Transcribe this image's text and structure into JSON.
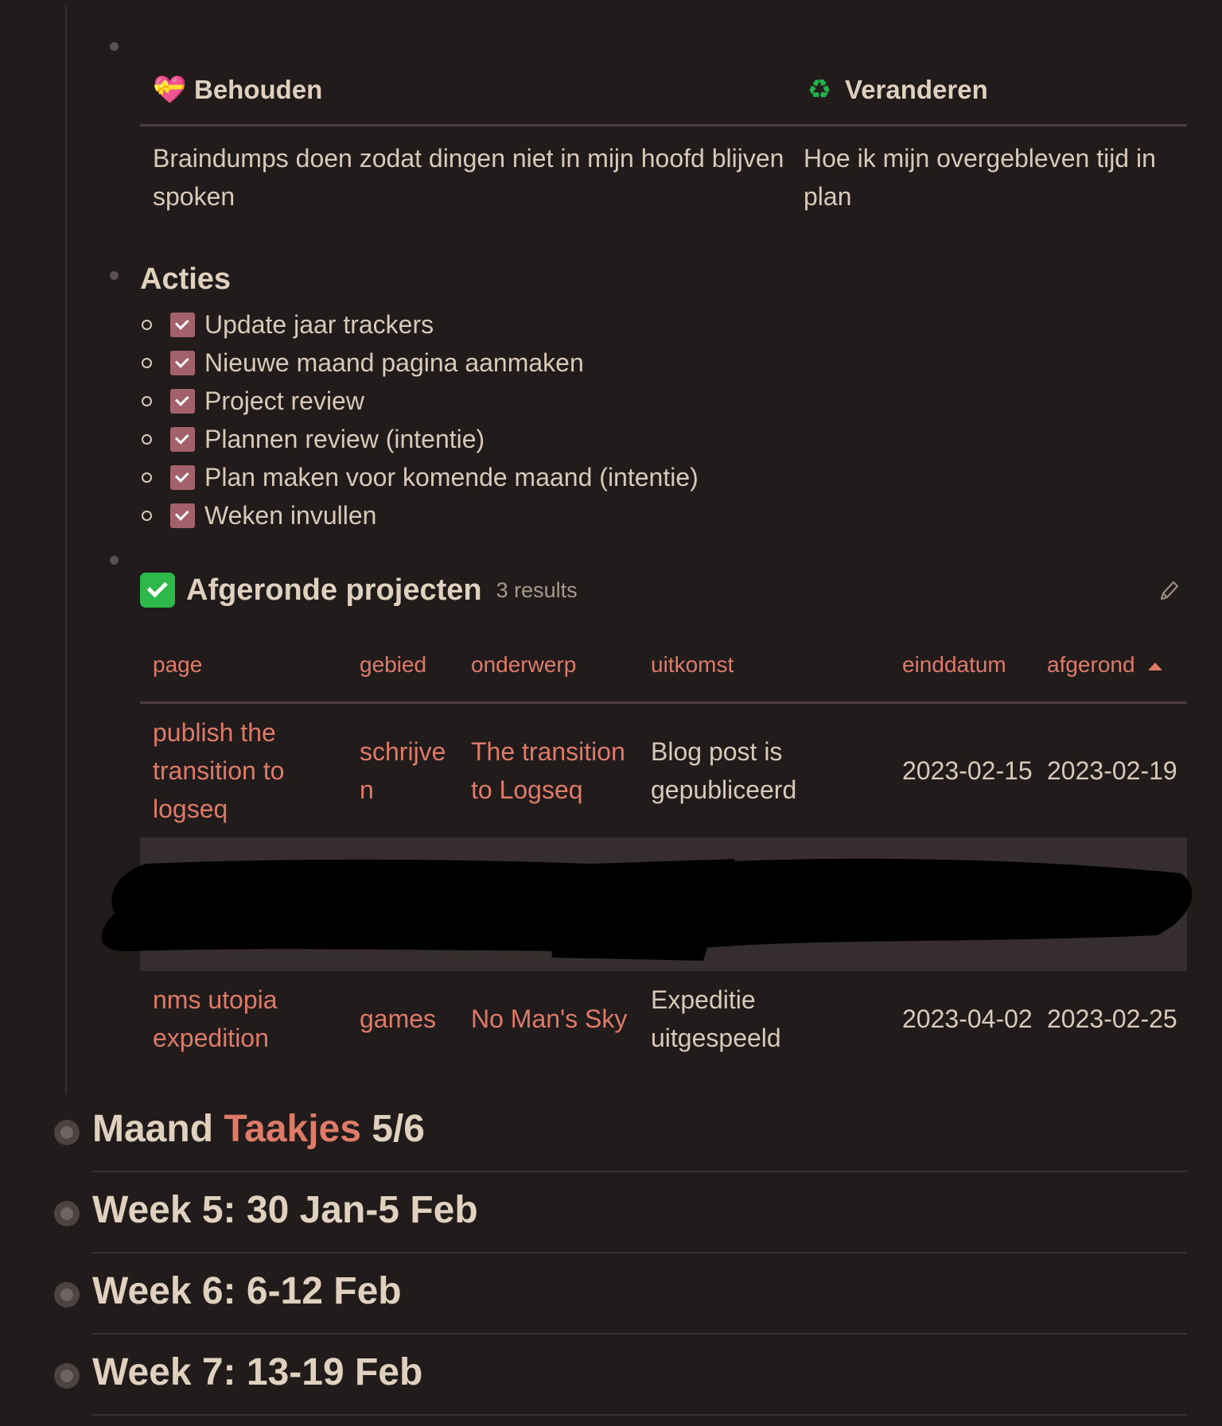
{
  "keep_change": {
    "headers": [
      {
        "emoji": "💝",
        "label": "Behouden"
      },
      {
        "emoji": "♻",
        "label": "Veranderen"
      }
    ],
    "row": [
      "Braindumps doen zodat dingen niet in mijn hoofd blijven spoken",
      "Hoe ik mijn overgebleven tijd in plan"
    ]
  },
  "acties": {
    "title": "Acties",
    "items": [
      {
        "label": "Update jaar trackers",
        "checked": true
      },
      {
        "label": "Nieuwe maand pagina aanmaken",
        "checked": true
      },
      {
        "label": "Project review",
        "checked": true
      },
      {
        "label": "Plannen review (intentie)",
        "checked": true
      },
      {
        "label": "Plan maken voor komende maand (intentie)",
        "checked": true
      },
      {
        "label": "Weken invullen",
        "checked": true
      }
    ]
  },
  "query": {
    "title": "Afgeronde projecten",
    "results": "3 results",
    "columns": [
      "page",
      "gebied",
      "onderwerp",
      "uitkomst",
      "einddatum",
      "afgerond"
    ],
    "sort_column": "afgerond",
    "rows": [
      {
        "page": "publish the transition to logseq",
        "gebied": "schrijven",
        "onderwerp": "The transition to Logseq",
        "uitkomst": "Blog post is gepubliceerd",
        "einddatum": "2023-02-15",
        "afgerond": "2023-02-19"
      },
      {
        "page": "nms utopia expedition",
        "gebied": "games",
        "onderwerp": "No Man's Sky",
        "uitkomst": "Expeditie uitgespeeld",
        "einddatum": "2023-04-02",
        "afgerond": "2023-02-25"
      }
    ]
  },
  "sections": [
    {
      "prefix": "Maand ",
      "ref": "Taakjes",
      "suffix": " 5/6"
    },
    {
      "prefix": "Week 5: 30 Jan-5 Feb",
      "ref": "",
      "suffix": ""
    },
    {
      "prefix": "Week 6: 6-12 Feb",
      "ref": "",
      "suffix": ""
    },
    {
      "prefix": "Week 7: 13-19 Feb",
      "ref": "",
      "suffix": ""
    }
  ],
  "colors": {
    "background": "#211b1c",
    "accent": "#dd7b68",
    "checkbox": "#a2616b"
  }
}
